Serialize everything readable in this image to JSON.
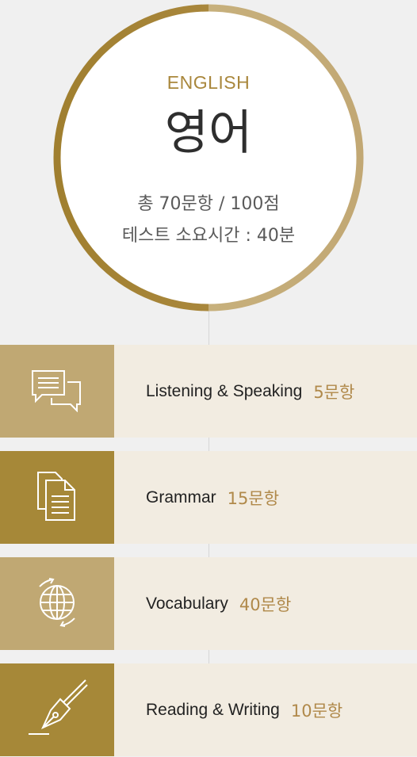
{
  "header": {
    "english_label": "ENGLISH",
    "korean_title": "영어",
    "total_info": "총 70문항 / 100점",
    "time_info": "테스트 소요시간 : 40분"
  },
  "colors": {
    "gold": "#a9873c",
    "gold_light": "#c0a873",
    "gold_dark": "#a68838",
    "row_bg": "#f2ece1"
  },
  "sections": [
    {
      "icon": "chat-bubbles-icon",
      "label": "Listening & Speaking",
      "count": "5문항"
    },
    {
      "icon": "documents-icon",
      "label": "Grammar",
      "count": "15문항"
    },
    {
      "icon": "globe-icon",
      "label": "Vocabulary",
      "count": "40문항"
    },
    {
      "icon": "fountain-pen-icon",
      "label": "Reading & Writing",
      "count": "10문항"
    }
  ]
}
